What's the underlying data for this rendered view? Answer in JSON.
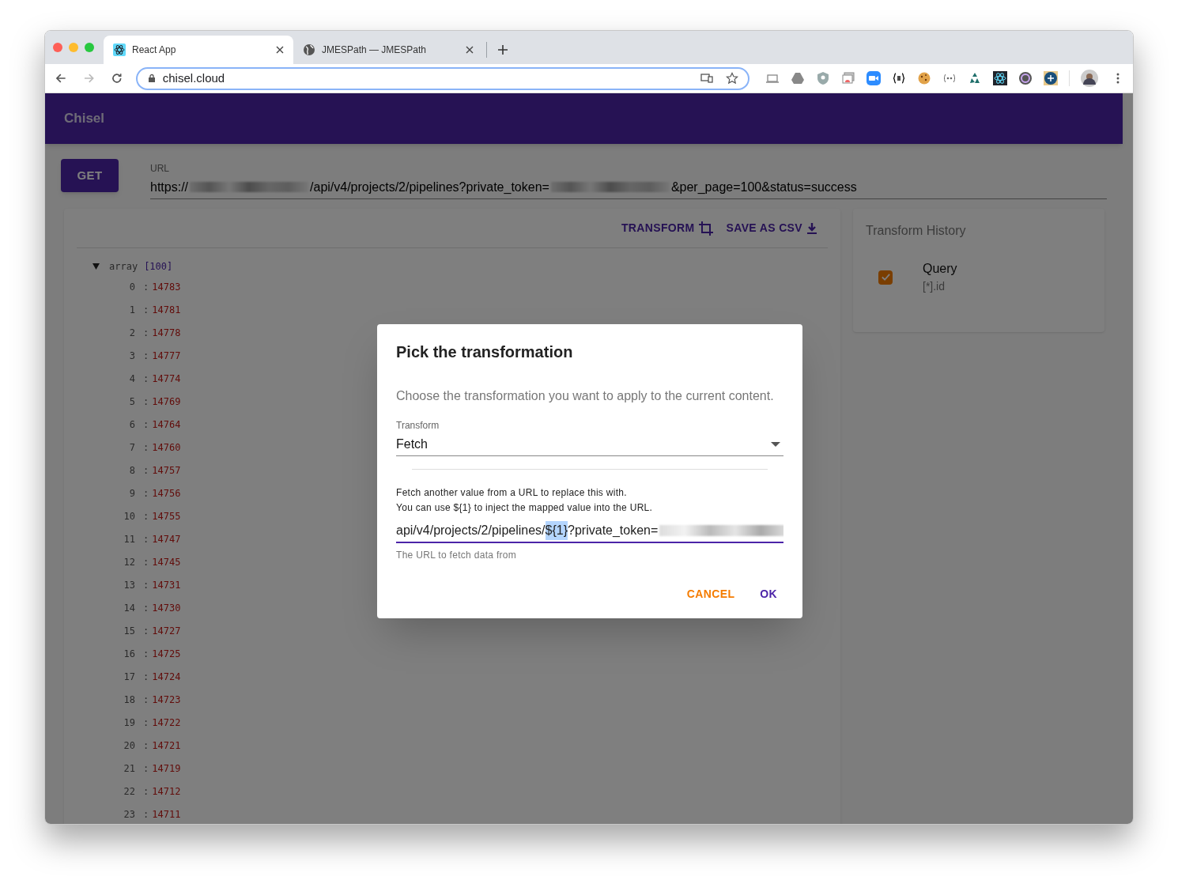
{
  "browser": {
    "tabs": [
      {
        "title": "React App",
        "selected": true
      },
      {
        "title": "JMESPath — JMESPath",
        "selected": false
      }
    ],
    "address": "chisel.cloud"
  },
  "app": {
    "title": "Chisel",
    "request": {
      "method": "GET",
      "url_label": "URL",
      "url_parts": [
        {
          "kind": "text",
          "text": "https://"
        },
        {
          "kind": "blurred"
        },
        {
          "kind": "text",
          "text": "/api/v4/projects/2/pipelines?private_token="
        },
        {
          "kind": "blurred"
        },
        {
          "kind": "text",
          "text": "&per_page=100&status=success"
        }
      ]
    },
    "actions": [
      {
        "label": "TRANSFORM"
      },
      {
        "label": "SAVE AS CSV"
      }
    ],
    "tree": {
      "name": "array",
      "count": "[100]",
      "expanded": true,
      "separator": ":",
      "items": [
        {
          "index": "0",
          "value": "14783"
        },
        {
          "index": "1",
          "value": "14781"
        },
        {
          "index": "2",
          "value": "14778"
        },
        {
          "index": "3",
          "value": "14777"
        },
        {
          "index": "4",
          "value": "14774"
        },
        {
          "index": "5",
          "value": "14769"
        },
        {
          "index": "6",
          "value": "14764"
        },
        {
          "index": "7",
          "value": "14760"
        },
        {
          "index": "8",
          "value": "14757"
        },
        {
          "index": "9",
          "value": "14756"
        },
        {
          "index": "10",
          "value": "14755"
        },
        {
          "index": "11",
          "value": "14747"
        },
        {
          "index": "12",
          "value": "14745"
        },
        {
          "index": "13",
          "value": "14731"
        },
        {
          "index": "14",
          "value": "14730"
        },
        {
          "index": "15",
          "value": "14727"
        },
        {
          "index": "16",
          "value": "14725"
        },
        {
          "index": "17",
          "value": "14724"
        },
        {
          "index": "18",
          "value": "14723"
        },
        {
          "index": "19",
          "value": "14722"
        },
        {
          "index": "20",
          "value": "14721"
        },
        {
          "index": "21",
          "value": "14719"
        },
        {
          "index": "22",
          "value": "14712"
        },
        {
          "index": "23",
          "value": "14711"
        }
      ]
    },
    "history": {
      "title": "Transform History",
      "items": [
        {
          "title": "Query",
          "detail": "[*].id",
          "checked": true
        }
      ]
    }
  },
  "dialog": {
    "title": "Pick the transformation",
    "description": "Choose the transformation you want to apply to the current content.",
    "select": {
      "label": "Transform",
      "value": "Fetch"
    },
    "help": [
      "Fetch another value from a URL to replace this with.",
      "You can use ${1} to inject the mapped value into the URL."
    ],
    "url_field": {
      "value_before": "api/v4/projects/2/pipelines/",
      "value_selected": "${1}",
      "value_after": "?private_token=",
      "helper": "The URL to fetch data from"
    },
    "buttons": [
      {
        "label": "CANCEL",
        "kind": "cancel"
      },
      {
        "label": "OK",
        "kind": "ok"
      }
    ]
  }
}
